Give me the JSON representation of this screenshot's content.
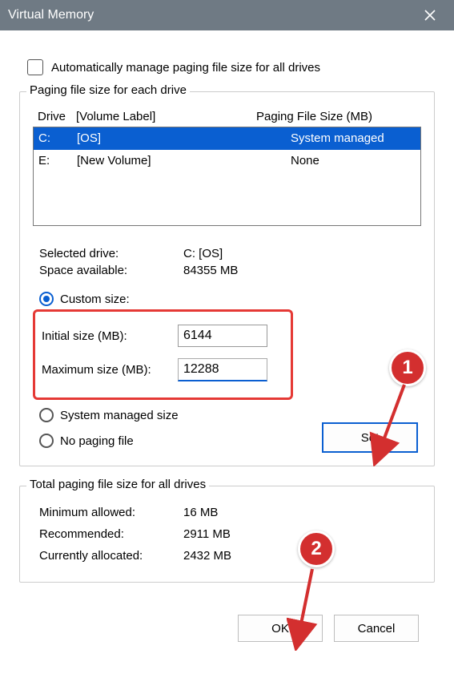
{
  "title": "Virtual Memory",
  "auto_manage_label": "Automatically manage paging file size for all drives",
  "auto_manage_checked": false,
  "group1": {
    "legend": "Paging file size for each drive",
    "head_drive": "Drive",
    "head_label": "[Volume Label]",
    "head_size": "Paging File Size (MB)",
    "rows": [
      {
        "drive": "C:",
        "label": "[OS]",
        "size": "System managed",
        "selected": true
      },
      {
        "drive": "E:",
        "label": "[New Volume]",
        "size": "None",
        "selected": false
      }
    ],
    "selected_drive_label": "Selected drive:",
    "selected_drive_value": "C:  [OS]",
    "space_label": "Space available:",
    "space_value": "84355 MB",
    "radio_custom_label": "Custom size:",
    "initial_label": "Initial size (MB):",
    "initial_value": "6144",
    "max_label": "Maximum size (MB):",
    "max_value": "12288",
    "radio_sysman_label": "System managed size",
    "radio_nopage_label": "No paging file",
    "set_label": "Set",
    "selected_radio": "custom"
  },
  "group2": {
    "legend": "Total paging file size for all drives",
    "min_label": "Minimum allowed:",
    "min_value": "16 MB",
    "rec_label": "Recommended:",
    "rec_value": "2911 MB",
    "cur_label": "Currently allocated:",
    "cur_value": "2432 MB"
  },
  "ok_label": "OK",
  "cancel_label": "Cancel",
  "annotations": {
    "badge1": "1",
    "badge2": "2"
  }
}
